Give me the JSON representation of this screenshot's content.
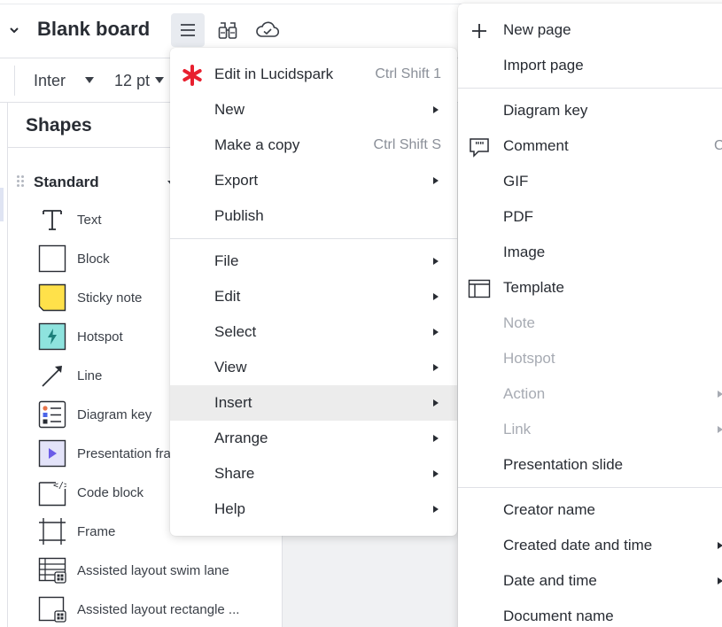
{
  "header": {
    "title": "Blank board",
    "menu_icon": "hamburger-menu-icon",
    "find_icon": "binoculars-icon",
    "cloud_icon": "cloud-saved-icon"
  },
  "format_bar": {
    "font": "Inter",
    "size": "12 pt"
  },
  "shapes_panel": {
    "title": "Shapes",
    "section": "Standard",
    "items": [
      {
        "label": "Text",
        "icon": "text-icon"
      },
      {
        "label": "Block",
        "icon": "block-icon"
      },
      {
        "label": "Sticky note",
        "icon": "sticky-note-icon"
      },
      {
        "label": "Hotspot",
        "icon": "hotspot-icon"
      },
      {
        "label": "Line",
        "icon": "line-icon"
      },
      {
        "label": "Diagram key",
        "icon": "diagram-key-icon"
      },
      {
        "label": "Presentation frame",
        "icon": "presentation-frame-icon"
      },
      {
        "label": "Code block",
        "icon": "code-block-icon"
      },
      {
        "label": "Frame",
        "icon": "frame-icon"
      },
      {
        "label": "Assisted layout swim lane",
        "icon": "swim-lane-icon"
      },
      {
        "label": "Assisted layout rectangle ...",
        "icon": "rectangle-layout-icon"
      }
    ]
  },
  "main_menu": {
    "items": [
      {
        "label": "Edit in Lucidspark",
        "shortcut": "Ctrl Shift 1",
        "icon": "lucidspark-icon"
      },
      {
        "label": "New",
        "submenu": true
      },
      {
        "label": "Make a copy",
        "shortcut": "Ctrl Shift S"
      },
      {
        "label": "Export",
        "submenu": true
      },
      {
        "label": "Publish"
      },
      {
        "label": "File",
        "submenu": true
      },
      {
        "label": "Edit",
        "submenu": true
      },
      {
        "label": "Select",
        "submenu": true
      },
      {
        "label": "View",
        "submenu": true
      },
      {
        "label": "Insert",
        "submenu": true,
        "active": true
      },
      {
        "label": "Arrange",
        "submenu": true
      },
      {
        "label": "Share",
        "submenu": true
      },
      {
        "label": "Help",
        "submenu": true
      }
    ]
  },
  "insert_menu": {
    "items": [
      {
        "label": "New page",
        "icon": "plus-icon"
      },
      {
        "label": "Import page"
      },
      {
        "label": "Diagram key"
      },
      {
        "label": "Comment",
        "icon": "comment-icon",
        "shortcut": "C"
      },
      {
        "label": "GIF"
      },
      {
        "label": "PDF"
      },
      {
        "label": "Image"
      },
      {
        "label": "Template",
        "icon": "template-icon"
      },
      {
        "label": "Note",
        "disabled": true
      },
      {
        "label": "Hotspot",
        "disabled": true
      },
      {
        "label": "Action",
        "disabled": true,
        "submenu": true
      },
      {
        "label": "Link",
        "disabled": true,
        "submenu": true
      },
      {
        "label": "Presentation slide"
      },
      {
        "label": "Creator name"
      },
      {
        "label": "Created date and time",
        "submenu": true
      },
      {
        "label": "Date and time",
        "submenu": true
      },
      {
        "label": "Document name"
      }
    ]
  }
}
